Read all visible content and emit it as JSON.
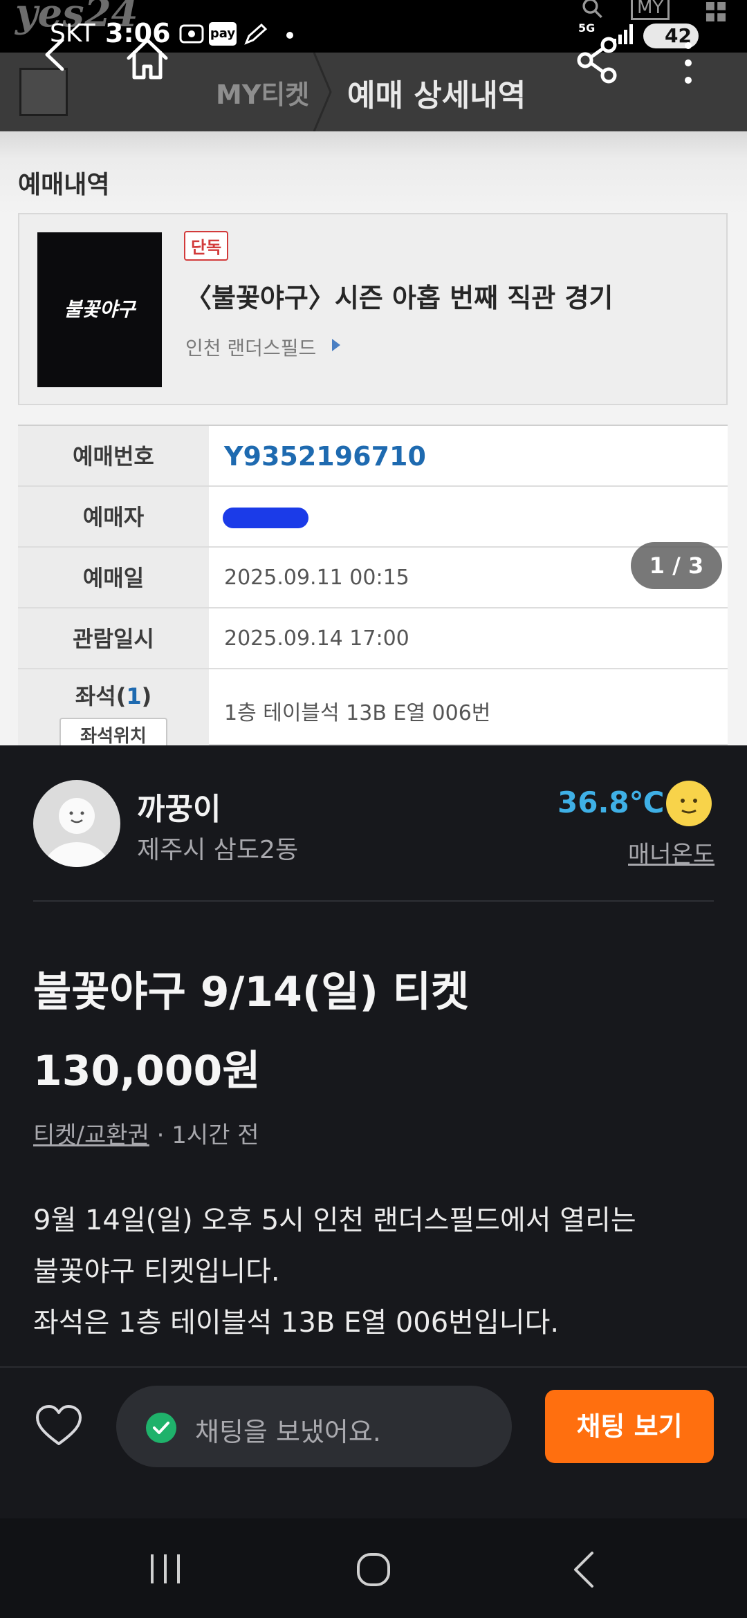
{
  "status_bar": {
    "logo": "yes24",
    "carrier": "SKT",
    "time": "3:06",
    "pay_label": "pay",
    "network": "5G",
    "battery": "42",
    "my_label": "MY"
  },
  "app_bar": {
    "breadcrumb": "MY티켓",
    "title": "예매 상세내역"
  },
  "booking": {
    "section_title": "예매내역",
    "poster_text": "불꽃야구",
    "badge": "단독",
    "event_title": "〈불꽃야구〉시즌 아홉 번째 직관 경기",
    "venue": "인천 랜더스필드",
    "rows": [
      {
        "label": "예매번호",
        "value": "Y9352196710"
      },
      {
        "label": "예매자",
        "value": ""
      },
      {
        "label": "예매일",
        "value": "2025.09.11 00:15"
      },
      {
        "label": "관람일시",
        "value": "2025.09.14 17:00"
      }
    ],
    "seat": {
      "label": "좌석",
      "count": "1",
      "button": "좌석위치",
      "value": "1층 테이블석 13B E열 006번"
    },
    "pager": "1 / 3"
  },
  "seller": {
    "name": "까꿍이",
    "location": "제주시 삼도2동",
    "temperature": "36.8℃",
    "manner_label": "매너온도"
  },
  "post": {
    "title": "불꽃야구 9/14(일) 티켓",
    "price": "130,000원",
    "category": "티켓/교환권",
    "time_ago": "· 1시간 전",
    "description": [
      "9월 14일(일) 오후 5시 인천 랜더스필드에서 열리는",
      "불꽃야구 티켓입니다.",
      "좌석은 1층 테이블석 13B E열 006번입니다."
    ]
  },
  "action_bar": {
    "toast": "채팅을 보냈어요.",
    "chat_button": "채팅 보기"
  },
  "colors": {
    "accent_orange": "#ff6f0f",
    "temp_blue": "#3fb0e6",
    "reservation_blue": "#1e6ab0",
    "success_green": "#1fb26b"
  },
  "icons": {
    "app_bar": [
      "back-icon",
      "home-icon",
      "share-icon",
      "more-vertical-icon"
    ],
    "action_bar": [
      "heart-icon",
      "check-circle-icon"
    ],
    "system_nav": [
      "recents-icon",
      "home-circle-icon",
      "nav-back-icon"
    ]
  }
}
